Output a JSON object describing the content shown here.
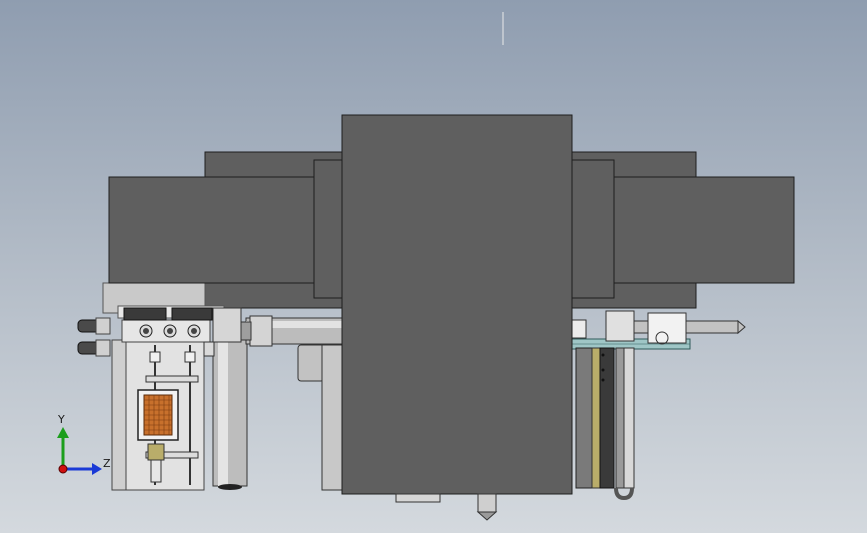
{
  "viewport": {
    "background_top": "#8f9db0",
    "background_bottom": "#d4d9de"
  },
  "model": {
    "body_color": "#5f5f5f",
    "body_outline": "#1e1e1e",
    "metal_light": "#d8d8d8",
    "metal_dark": "#9a9a9a",
    "brass": "#b9ad6a",
    "copper": "#c8702c",
    "glass": "#9fc6c6"
  },
  "triad": {
    "y_label": "Y",
    "z_label": "Z",
    "y_color": "#1c9e1c",
    "z_color": "#1a3ad6",
    "origin_color": "#d01010"
  }
}
